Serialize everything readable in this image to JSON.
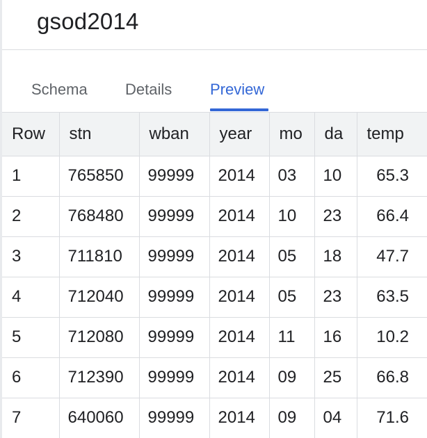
{
  "table_name": "gsod2014",
  "tabs": [
    {
      "label": "Schema",
      "active": false
    },
    {
      "label": "Details",
      "active": false
    },
    {
      "label": "Preview",
      "active": true
    }
  ],
  "accent_color": "#3367d6",
  "columns": [
    "Row",
    "stn",
    "wban",
    "year",
    "mo",
    "da",
    "temp"
  ],
  "rows": [
    [
      "1",
      "765850",
      "99999",
      "2014",
      "03",
      "10",
      "65.3"
    ],
    [
      "2",
      "768480",
      "99999",
      "2014",
      "10",
      "23",
      "66.4"
    ],
    [
      "3",
      "711810",
      "99999",
      "2014",
      "05",
      "18",
      "47.7"
    ],
    [
      "4",
      "712040",
      "99999",
      "2014",
      "05",
      "23",
      "63.5"
    ],
    [
      "5",
      "712080",
      "99999",
      "2014",
      "11",
      "16",
      "10.2"
    ],
    [
      "6",
      "712390",
      "99999",
      "2014",
      "09",
      "25",
      "66.8"
    ],
    [
      "7",
      "640060",
      "99999",
      "2014",
      "09",
      "04",
      "71.6"
    ]
  ]
}
